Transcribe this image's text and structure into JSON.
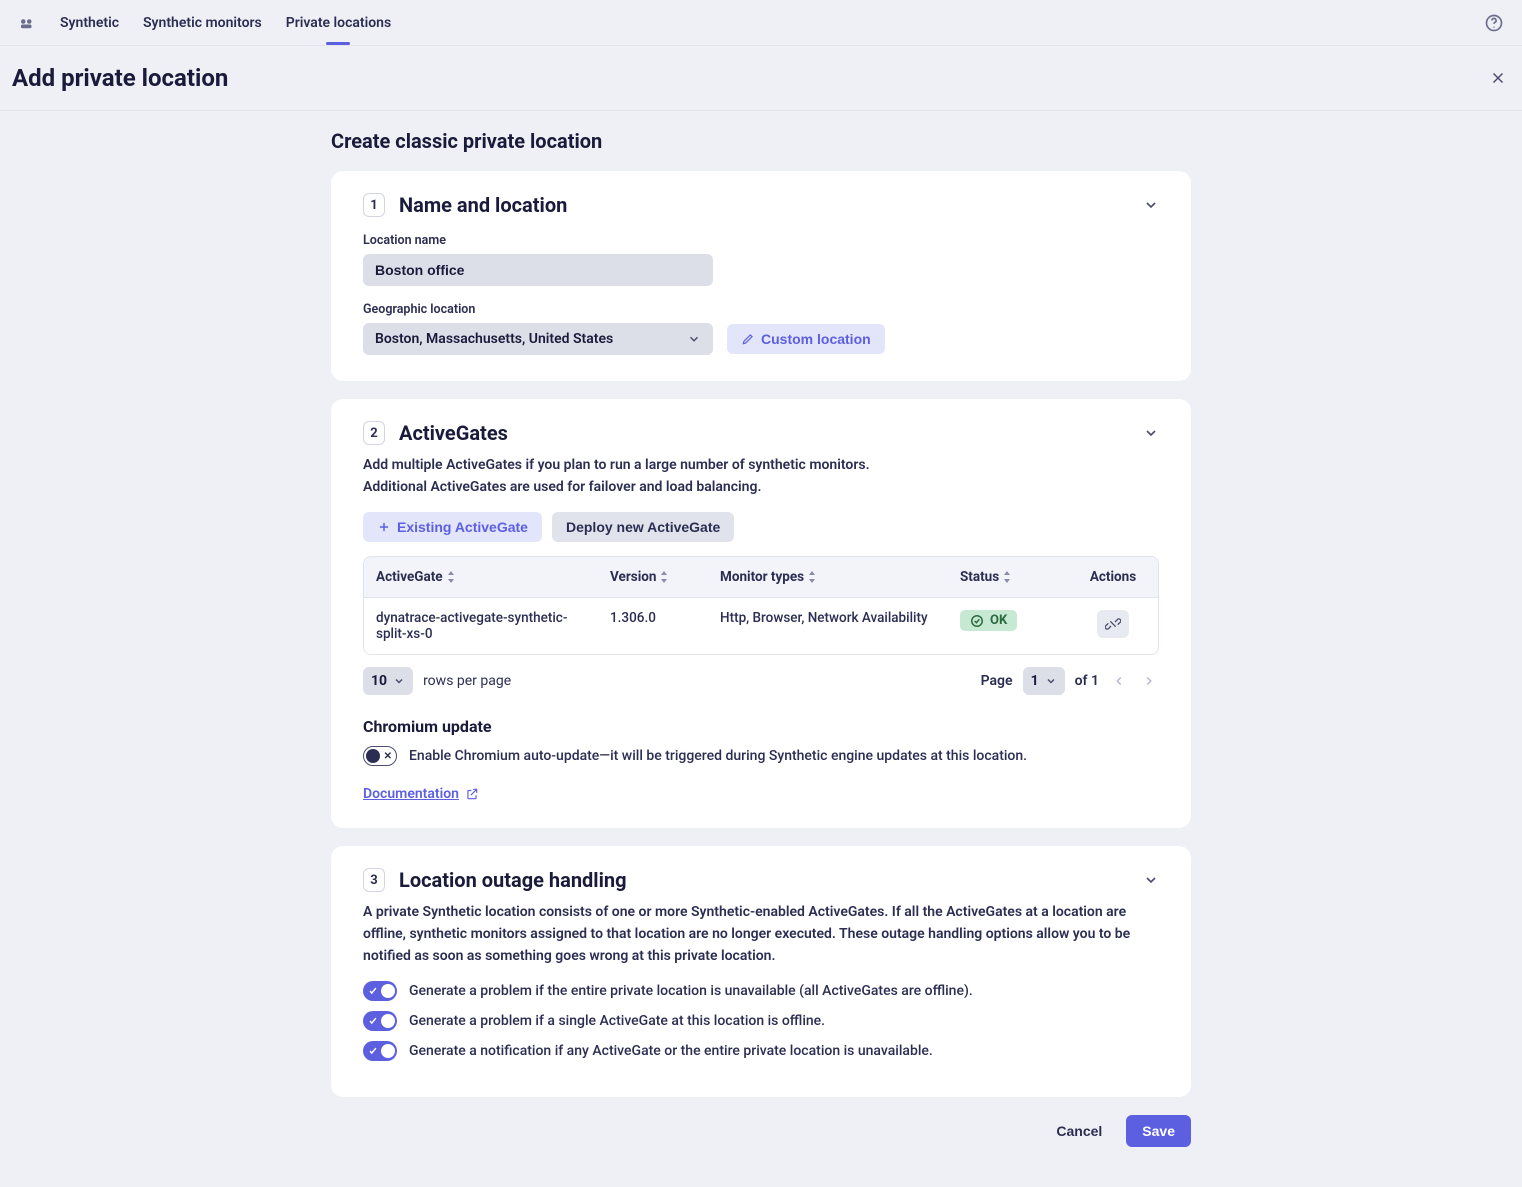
{
  "nav": {
    "items": [
      "Synthetic",
      "Synthetic monitors",
      "Private locations"
    ],
    "activeIndex": 2
  },
  "page": {
    "title": "Add private location",
    "sectionTitle": "Create classic private location"
  },
  "step1": {
    "number": "1",
    "title": "Name and location",
    "nameLabel": "Location name",
    "nameValue": "Boston office",
    "geoLabel": "Geographic location",
    "geoValue": "Boston, Massachusetts, United States",
    "customBtn": "Custom location"
  },
  "step2": {
    "number": "2",
    "title": "ActiveGates",
    "help1": "Add multiple ActiveGates if you plan to run a large number of synthetic monitors.",
    "help2": "Additional ActiveGates are used for failover and load balancing.",
    "existingBtn": "Existing ActiveGate",
    "deployBtn": "Deploy new ActiveGate",
    "table": {
      "headers": {
        "ag": "ActiveGate",
        "version": "Version",
        "monitor": "Monitor types",
        "status": "Status",
        "actions": "Actions"
      },
      "rows": [
        {
          "ag": "dynatrace-activegate-synthetic-split-xs-0",
          "version": "1.306.0",
          "monitor": "Http, Browser, Network Availability",
          "status": "OK"
        }
      ]
    },
    "pager": {
      "rowsPerPageValue": "10",
      "rowsPerPageLabel": "rows per page",
      "pageLabel": "Page",
      "pageValue": "1",
      "ofLabel": "of 1"
    },
    "chromiumTitle": "Chromium update",
    "chromiumText": "Enable Chromium auto-update—it will be triggered during Synthetic engine updates at this location.",
    "docLink": "Documentation"
  },
  "step3": {
    "number": "3",
    "title": "Location outage handling",
    "help": "A private Synthetic location consists of one or more Synthetic-enabled ActiveGates. If all the ActiveGates at a location are offline, synthetic monitors assigned to that location are no longer executed. These outage handling options allow you to be notified as soon as something goes wrong at this private location.",
    "opt1": "Generate a problem if the entire private location is unavailable (all ActiveGates are offline).",
    "opt2": "Generate a problem if a single ActiveGate at this location is offline.",
    "opt3": "Generate a notification if any ActiveGate or the entire private location is unavailable."
  },
  "footer": {
    "cancel": "Cancel",
    "save": "Save"
  }
}
